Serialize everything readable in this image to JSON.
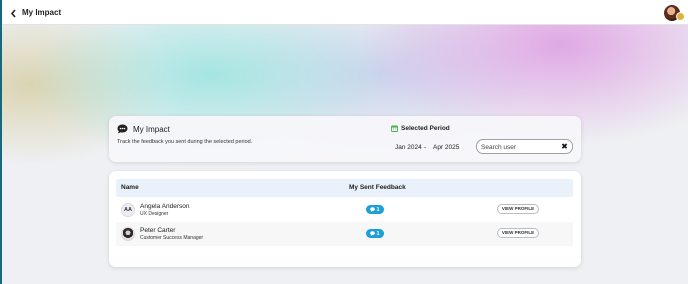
{
  "header": {
    "title": "My Impact",
    "back_icon": "chevron-left-icon",
    "user_avatar": "avatar"
  },
  "impact_card": {
    "title": "My Impact",
    "subtitle": "Track the feedback you sent during the selected period.",
    "icon": "chat-bubble-icon"
  },
  "period": {
    "label": "Selected Period",
    "icon": "calendar-icon",
    "from": "Jan 2024",
    "separator": "-",
    "to": "Apr 2025"
  },
  "search": {
    "placeholder": "Search user",
    "value": "",
    "clear_symbol": "✖"
  },
  "table": {
    "columns": [
      "Name",
      "My Sent Feedback"
    ],
    "rows": [
      {
        "initials": "AA",
        "name": "Angela Anderson",
        "role": "UX Designer",
        "feedback_count": "1",
        "action": "VIEW PROFILE"
      },
      {
        "initials": "",
        "name": "Peter Carter",
        "role": "Customer Success Manager",
        "feedback_count": "1",
        "action": "VIEW PROFILE"
      }
    ]
  },
  "colors": {
    "accent": "#1d9fd8",
    "table_header": "#e9f1fa",
    "calendar_green": "#4caf50"
  }
}
